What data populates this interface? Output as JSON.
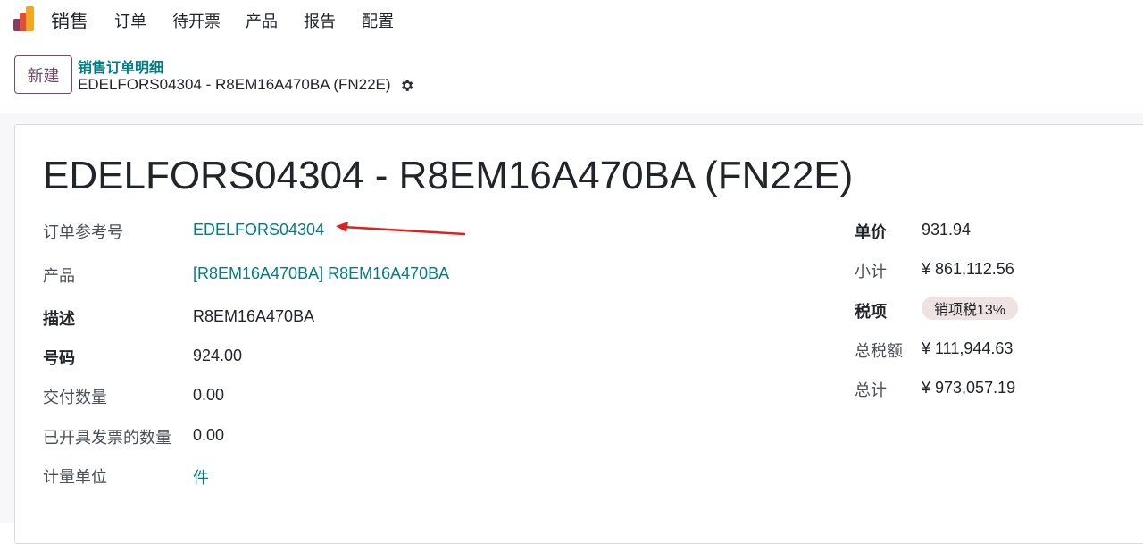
{
  "app": {
    "name": "销售",
    "nav": [
      "订单",
      "待开票",
      "产品",
      "报告",
      "配置"
    ]
  },
  "control_panel": {
    "new_button": "新建",
    "breadcrumb_parent": "销售订单明细",
    "breadcrumb_current": "EDELFORS04304 - R8EM16A470BA (FN22E)"
  },
  "record": {
    "title": "EDELFORS04304 - R8EM16A470BA (FN22E)",
    "left_fields": [
      {
        "label": "订单参考号",
        "value": "EDELFORS04304"
      },
      {
        "label": "产品",
        "value": "[R8EM16A470BA] R8EM16A470BA"
      },
      {
        "label": "描述",
        "value": "R8EM16A470BA"
      },
      {
        "label": "号码",
        "value": "924.00"
      },
      {
        "label": "交付数量",
        "value": "0.00"
      },
      {
        "label": "已开具发票的数量",
        "value": "0.00"
      },
      {
        "label": "计量单位",
        "value": "件"
      }
    ],
    "right_fields": [
      {
        "label": "单价",
        "value": "931.94"
      },
      {
        "label": "小计",
        "value": "¥ 861,112.56"
      },
      {
        "label": "税项",
        "value": "销项税13%"
      },
      {
        "label": "总税额",
        "value": "¥ 111,944.63"
      },
      {
        "label": "总计",
        "value": "¥ 973,057.19"
      }
    ]
  },
  "colors": {
    "brand": "#714B67",
    "link": "#017e84",
    "annotation_arrow": "#e02020",
    "tax_badge_bg": "#eee2e2"
  }
}
